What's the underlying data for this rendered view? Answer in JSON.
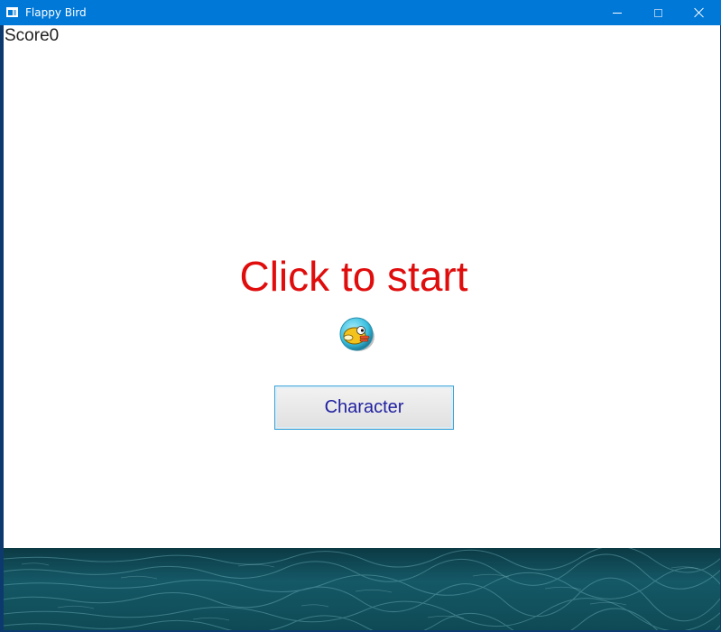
{
  "window": {
    "title": "Flappy Bird",
    "titlebar_color": "#0078d7",
    "icon": "app-window-icon",
    "controls": [
      "minimize-icon",
      "maximize-icon",
      "close-icon"
    ]
  },
  "game": {
    "score_text": "Score0",
    "start_text": "Click to start",
    "start_text_color": "#e00d0d",
    "character_button_label": "Character",
    "bird_icon": "flappy-bird-icon",
    "ground": "sea-water-texture",
    "sea_color": "#0e4a55"
  }
}
